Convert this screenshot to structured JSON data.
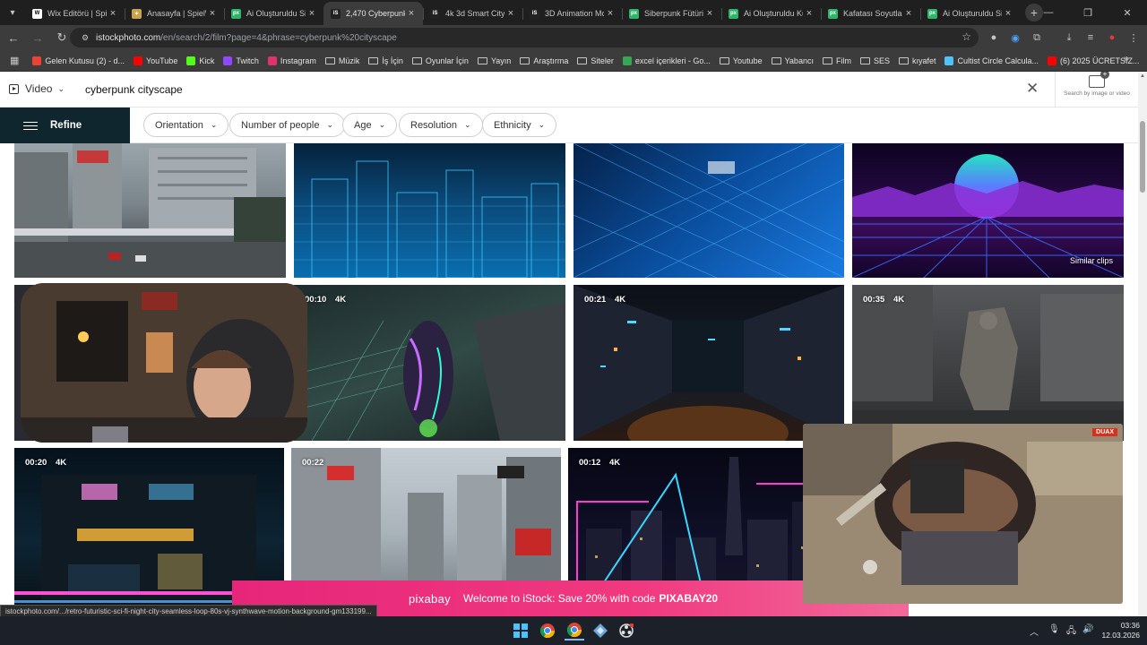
{
  "browser": {
    "tabs": [
      {
        "title": "Wix Editörü | Spie",
        "icon": "wix-favicon",
        "color": "#ffffff",
        "active": false
      },
      {
        "title": "Anasayfa | SpielW",
        "icon": "spielw-favicon",
        "color": "#c9a44c",
        "active": false
      },
      {
        "title": "Ai Oluşturuldu Si",
        "icon": "pexels-favicon",
        "color": "#2fb56a",
        "active": false
      },
      {
        "title": "2,470 Cyberpunk",
        "icon": "istock-favicon",
        "color": "#222222",
        "active": true
      },
      {
        "title": "4k 3d Smart City",
        "icon": "istock-favicon",
        "color": "#222222",
        "active": false
      },
      {
        "title": "3D Animation Mo",
        "icon": "istock-favicon",
        "color": "#222222",
        "active": false
      },
      {
        "title": "Siberpunk Fütüris",
        "icon": "pexels-favicon",
        "color": "#2fb56a",
        "active": false
      },
      {
        "title": "Ai Oluşturuldu Ku",
        "icon": "pexels-favicon",
        "color": "#2fb56a",
        "active": false
      },
      {
        "title": "Kafatası Soyutlam",
        "icon": "pexels-favicon",
        "color": "#2fb56a",
        "active": false
      },
      {
        "title": "Ai Oluşturuldu Si",
        "icon": "pexels-favicon",
        "color": "#2fb56a",
        "active": false
      }
    ],
    "url_host": "istockphoto.com",
    "url_path": "/en/search/2/film?page=4&phrase=cyberpunk%20cityscape"
  },
  "bookmarks": [
    {
      "label": "Gelen Kutusu (2) - d...",
      "icon": "gmail-icon",
      "color": "#ea4335"
    },
    {
      "label": "YouTube",
      "icon": "youtube-icon",
      "color": "#ff0000"
    },
    {
      "label": "Kick",
      "icon": "kick-icon",
      "color": "#53fc18"
    },
    {
      "label": "Twitch",
      "icon": "twitch-icon",
      "color": "#9146ff"
    },
    {
      "label": "Instagram",
      "icon": "instagram-icon",
      "color": "#e1306c"
    },
    {
      "label": "Müzik",
      "icon": "folder-icon",
      "color": ""
    },
    {
      "label": "İş İçin",
      "icon": "folder-icon",
      "color": ""
    },
    {
      "label": "Oyunlar İçin",
      "icon": "folder-icon",
      "color": ""
    },
    {
      "label": "Yayın",
      "icon": "folder-icon",
      "color": ""
    },
    {
      "label": "Araştırma",
      "icon": "folder-icon",
      "color": ""
    },
    {
      "label": "Siteler",
      "icon": "folder-icon",
      "color": ""
    },
    {
      "label": "excel içerikleri - Go...",
      "icon": "sheets-icon",
      "color": "#34a853"
    },
    {
      "label": "Youtube",
      "icon": "folder-icon",
      "color": ""
    },
    {
      "label": "Yabancı",
      "icon": "folder-icon",
      "color": ""
    },
    {
      "label": "Film",
      "icon": "folder-icon",
      "color": ""
    },
    {
      "label": "SES",
      "icon": "folder-icon",
      "color": ""
    },
    {
      "label": "kıyafet",
      "icon": "folder-icon",
      "color": ""
    },
    {
      "label": "Cultist Circle Calcula...",
      "icon": "cultist-icon",
      "color": "#4fc3f7"
    },
    {
      "label": "(6) 2025 ÜCRETSİZ...",
      "icon": "youtube-icon",
      "color": "#ff0000"
    }
  ],
  "search": {
    "media_type": "Video",
    "query": "cyberpunk cityscape",
    "search_by_image": "Search by image or video"
  },
  "filters": {
    "refine": "Refine",
    "chips": [
      "Orientation",
      "Number of people",
      "Age",
      "Resolution",
      "Ethnicity"
    ]
  },
  "results": [
    {
      "duration": "",
      "res": "",
      "label": "",
      "theme": "street"
    },
    {
      "duration": "",
      "res": "",
      "label": "",
      "theme": "holo-blue"
    },
    {
      "duration": "",
      "res": "",
      "label": "",
      "theme": "holo-grid"
    },
    {
      "duration": "",
      "res": "",
      "label": "Similar clips",
      "theme": "synthwave"
    },
    {
      "duration": "",
      "res": "",
      "label": "",
      "theme": "webcam-under"
    },
    {
      "duration": "00:10",
      "res": "4K",
      "label": "",
      "theme": "neon-fighter"
    },
    {
      "duration": "00:21",
      "res": "4K",
      "label": "",
      "theme": "dark-corridor"
    },
    {
      "duration": "00:35",
      "res": "4K",
      "label": "",
      "theme": "robot-street"
    },
    {
      "duration": "00:20",
      "res": "4K",
      "label": "",
      "theme": "neon-building"
    },
    {
      "duration": "00:22",
      "res": "",
      "label": "",
      "theme": "shibuya"
    },
    {
      "duration": "00:12",
      "res": "4K",
      "label": "",
      "theme": "neon-skyline"
    }
  ],
  "promo": {
    "brand": "pixabay",
    "text": "Welcome to iStock: Save 20% with code",
    "code": "PIXABAY20"
  },
  "status_url": "istockphoto.com/.../retro-futuristic-sci-fi-night-city-seamless-loop-80s-vj-synthwave-motion-background-gm133199...",
  "pip_badge": "DUAX",
  "taskbar": {
    "time": "03:36",
    "date": "12.03.2026"
  }
}
